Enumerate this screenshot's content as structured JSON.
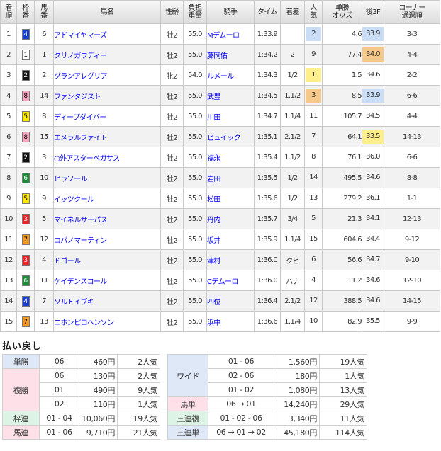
{
  "headers": {
    "rank": [
      "着",
      "順"
    ],
    "waku": [
      "枠",
      "番"
    ],
    "num": [
      "馬",
      "番"
    ],
    "name": "馬名",
    "age": "性齢",
    "weight": [
      "負担",
      "重量"
    ],
    "jockey": "騎手",
    "time": "タイム",
    "margin": "着差",
    "pop": [
      "人",
      "気"
    ],
    "odds": [
      "単勝",
      "オッズ"
    ],
    "last3f": "後3F",
    "corner": [
      "コーナー",
      "通過順"
    ]
  },
  "rows": [
    {
      "rank": "1",
      "waku": "4",
      "num": "6",
      "name": "アドマイヤマーズ",
      "age": "牡2",
      "weight": "55.0",
      "jockey": "Mデムーロ",
      "time": "1:33.9",
      "margin": "",
      "pop": "2",
      "odds": "4.6",
      "last3f": "33.9",
      "corner": "3-3"
    },
    {
      "rank": "2",
      "waku": "1",
      "num": "1",
      "name": "クリノガウディー",
      "age": "牡2",
      "weight": "55.0",
      "jockey": "藤岡佑",
      "time": "1:34.2",
      "margin": "2",
      "pop": "9",
      "odds": "77.4",
      "last3f": "34.0",
      "corner": "4-4"
    },
    {
      "rank": "3",
      "waku": "2",
      "num": "2",
      "name": "グランアレグリア",
      "age": "牝2",
      "weight": "54.0",
      "jockey": "ルメール",
      "time": "1:34.3",
      "margin": "1/2",
      "pop": "1",
      "odds": "1.5",
      "last3f": "34.6",
      "corner": "2-2"
    },
    {
      "rank": "4",
      "waku": "8",
      "num": "14",
      "name": "ファンタジスト",
      "age": "牡2",
      "weight": "55.0",
      "jockey": "武豊",
      "time": "1:34.5",
      "margin": "1.1/2",
      "pop": "3",
      "odds": "8.5",
      "last3f": "33.9",
      "corner": "6-6"
    },
    {
      "rank": "5",
      "waku": "5",
      "num": "8",
      "name": "ディープダイバー",
      "age": "牡2",
      "weight": "55.0",
      "jockey": "川田",
      "time": "1:34.7",
      "margin": "1.1/4",
      "pop": "11",
      "odds": "105.7",
      "last3f": "34.5",
      "corner": "4-4"
    },
    {
      "rank": "6",
      "waku": "8",
      "num": "15",
      "name": "エメラルファイト",
      "age": "牡2",
      "weight": "55.0",
      "jockey": "ビュイック",
      "time": "1:35.1",
      "margin": "2.1/2",
      "pop": "7",
      "odds": "64.1",
      "last3f": "33.5",
      "corner": "14-13"
    },
    {
      "rank": "7",
      "waku": "2",
      "num": "3",
      "name": "○外アスターペガサス",
      "age": "牡2",
      "weight": "55.0",
      "jockey": "福永",
      "time": "1:35.4",
      "margin": "1.1/2",
      "pop": "8",
      "odds": "76.1",
      "last3f": "36.0",
      "corner": "6-6"
    },
    {
      "rank": "8",
      "waku": "6",
      "num": "10",
      "name": "ヒラソール",
      "age": "牡2",
      "weight": "55.0",
      "jockey": "岩田",
      "time": "1:35.5",
      "margin": "1/2",
      "pop": "14",
      "odds": "495.5",
      "last3f": "34.6",
      "corner": "8-8"
    },
    {
      "rank": "9",
      "waku": "5",
      "num": "9",
      "name": "イッツクール",
      "age": "牡2",
      "weight": "55.0",
      "jockey": "松田",
      "time": "1:35.6",
      "margin": "1/2",
      "pop": "13",
      "odds": "279.2",
      "last3f": "36.1",
      "corner": "1-1"
    },
    {
      "rank": "10",
      "waku": "3",
      "num": "5",
      "name": "マイネルサーパス",
      "age": "牡2",
      "weight": "55.0",
      "jockey": "丹内",
      "time": "1:35.7",
      "margin": "3/4",
      "pop": "5",
      "odds": "21.3",
      "last3f": "34.1",
      "corner": "12-13"
    },
    {
      "rank": "11",
      "waku": "7",
      "num": "12",
      "name": "コパノマーティン",
      "age": "牡2",
      "weight": "55.0",
      "jockey": "坂井",
      "time": "1:35.9",
      "margin": "1.1/4",
      "pop": "15",
      "odds": "604.6",
      "last3f": "34.4",
      "corner": "9-12"
    },
    {
      "rank": "12",
      "waku": "3",
      "num": "4",
      "name": "ドゴール",
      "age": "牡2",
      "weight": "55.0",
      "jockey": "津村",
      "time": "1:36.0",
      "margin": "クビ",
      "pop": "6",
      "odds": "56.6",
      "last3f": "34.7",
      "corner": "9-10"
    },
    {
      "rank": "13",
      "waku": "6",
      "num": "11",
      "name": "ケイデンスコール",
      "age": "牡2",
      "weight": "55.0",
      "jockey": "Cデムーロ",
      "time": "1:36.0",
      "margin": "ハナ",
      "pop": "4",
      "odds": "11.2",
      "last3f": "34.6",
      "corner": "12-10"
    },
    {
      "rank": "14",
      "waku": "4",
      "num": "7",
      "name": "ソルトイブキ",
      "age": "牡2",
      "weight": "55.0",
      "jockey": "四位",
      "time": "1:36.4",
      "margin": "2.1/2",
      "pop": "12",
      "odds": "388.5",
      "last3f": "34.6",
      "corner": "14-15"
    },
    {
      "rank": "15",
      "waku": "7",
      "num": "13",
      "name": "ニホンピロヘンソン",
      "age": "牡2",
      "weight": "55.0",
      "jockey": "浜中",
      "time": "1:36.6",
      "margin": "1.1/4",
      "pop": "10",
      "odds": "82.9",
      "last3f": "35.5",
      "corner": "9-9"
    }
  ],
  "payout_title": "払い戻し",
  "payouts_left": [
    {
      "type": "単勝",
      "color": "blue",
      "lines": [
        {
          "combo": "06",
          "amount": "460円",
          "pop": "2人気"
        }
      ]
    },
    {
      "type": "複勝",
      "color": "pink",
      "lines": [
        {
          "combo": "06",
          "amount": "130円",
          "pop": "2人気"
        },
        {
          "combo": "01",
          "amount": "490円",
          "pop": "9人気"
        },
        {
          "combo": "02",
          "amount": "110円",
          "pop": "1人気"
        }
      ]
    },
    {
      "type": "枠連",
      "color": "mint",
      "lines": [
        {
          "combo": "01 - 04",
          "amount": "10,060円",
          "pop": "19人気"
        }
      ]
    },
    {
      "type": "馬連",
      "color": "pink",
      "lines": [
        {
          "combo": "01 - 06",
          "amount": "9,710円",
          "pop": "21人気"
        }
      ]
    }
  ],
  "payouts_right": [
    {
      "type": "ワイド",
      "color": "blue",
      "lines": [
        {
          "combo": "01 - 06",
          "amount": "1,560円",
          "pop": "19人気"
        },
        {
          "combo": "02 - 06",
          "amount": "180円",
          "pop": "1人気"
        },
        {
          "combo": "01 - 02",
          "amount": "1,080円",
          "pop": "13人気"
        }
      ]
    },
    {
      "type": "馬単",
      "color": "pink",
      "lines": [
        {
          "combo": "06 → 01",
          "amount": "14,240円",
          "pop": "29人気"
        }
      ]
    },
    {
      "type": "三連複",
      "color": "mint",
      "lines": [
        {
          "combo": "01 - 02 - 06",
          "amount": "3,340円",
          "pop": "11人気"
        }
      ]
    },
    {
      "type": "三連単",
      "color": "blue",
      "lines": [
        {
          "combo": "06 → 01 → 02",
          "amount": "45,180円",
          "pop": "114人気"
        }
      ]
    }
  ],
  "colors": {
    "waku": {
      "1": {
        "bg": "#ffffff",
        "fg": "#000000"
      },
      "2": {
        "bg": "#111111",
        "fg": "#ffffff"
      },
      "3": {
        "bg": "#e8242a",
        "fg": "#ffffff"
      },
      "4": {
        "bg": "#1a3fd0",
        "fg": "#ffffff"
      },
      "5": {
        "bg": "#ffe800",
        "fg": "#000000"
      },
      "6": {
        "bg": "#1e8a3a",
        "fg": "#ffffff"
      },
      "7": {
        "bg": "#f39b21",
        "fg": "#000000"
      },
      "8": {
        "bg": "#f7a6c0",
        "fg": "#000000"
      }
    },
    "pop_highlight": {
      "1": "#ffef8a",
      "2": "#c9ddf7",
      "3": "#f5c98a"
    },
    "last3f_highlight": {
      "33.5": "#ffef8a",
      "33.9": "#c9ddf7",
      "34.0": "#f5c98a"
    }
  }
}
